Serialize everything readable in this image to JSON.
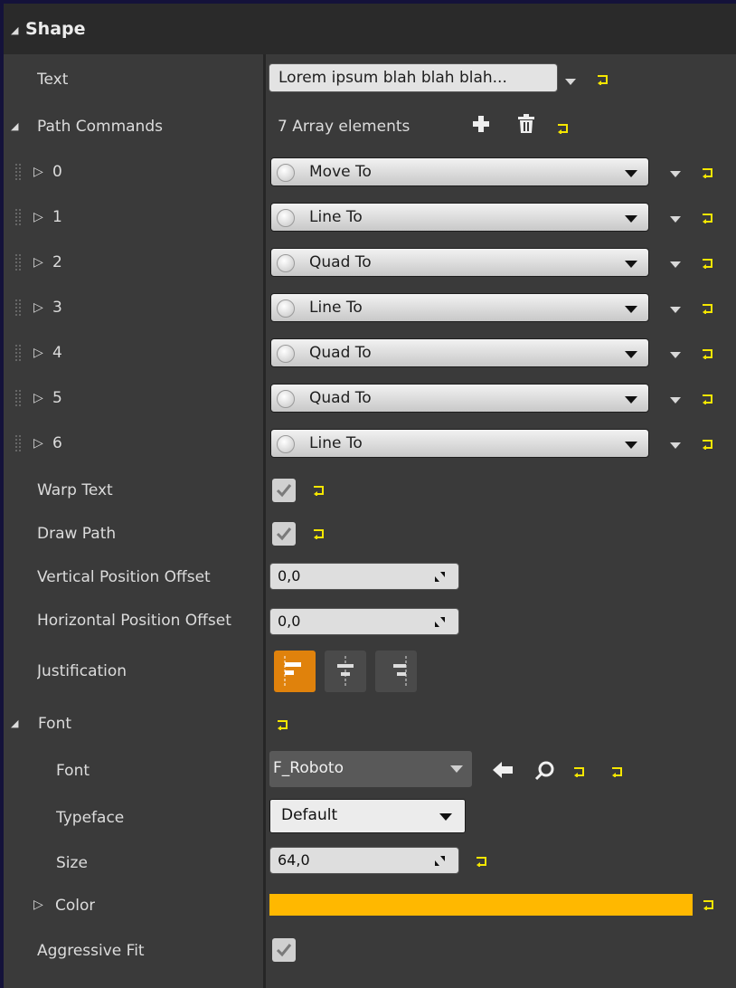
{
  "section": {
    "title": "Shape"
  },
  "text_prop": {
    "label": "Text",
    "value": "Lorem ipsum blah blah blah..."
  },
  "path_commands": {
    "label": "Path Commands",
    "count_text": "7 Array elements",
    "items": [
      {
        "index": "0",
        "value": "Move To"
      },
      {
        "index": "1",
        "value": "Line To"
      },
      {
        "index": "2",
        "value": "Quad To"
      },
      {
        "index": "3",
        "value": "Line To"
      },
      {
        "index": "4",
        "value": "Quad To"
      },
      {
        "index": "5",
        "value": "Quad To"
      },
      {
        "index": "6",
        "value": "Line To"
      }
    ]
  },
  "warp_text": {
    "label": "Warp Text",
    "checked": true
  },
  "draw_path": {
    "label": "Draw Path",
    "checked": true
  },
  "vertical_offset": {
    "label": "Vertical Position Offset",
    "value": "0,0"
  },
  "horizontal_offset": {
    "label": "Horizontal Position Offset",
    "value": "0,0"
  },
  "justification": {
    "label": "Justification",
    "options": [
      "left",
      "center",
      "right"
    ],
    "selected": "left"
  },
  "font_group": {
    "label": "Font",
    "font": {
      "label": "Font",
      "value": "F_Roboto"
    },
    "typeface": {
      "label": "Typeface",
      "value": "Default"
    },
    "size": {
      "label": "Size",
      "value": "64,0"
    },
    "color": {
      "label": "Color",
      "value": "#ffb800"
    }
  },
  "aggressive_fit": {
    "label": "Aggressive Fit",
    "checked": true
  },
  "colors": {
    "accent": "#e0820c",
    "reset": "#f5e600",
    "panel": "#3a3a3a",
    "header": "#2a2a2a"
  },
  "icons": [
    "collapse-triangle-icon",
    "expand-triangle-icon",
    "reset-to-default-icon",
    "add-icon",
    "trash-icon",
    "arrow-left-icon",
    "search-icon",
    "drag-handle-icon"
  ]
}
